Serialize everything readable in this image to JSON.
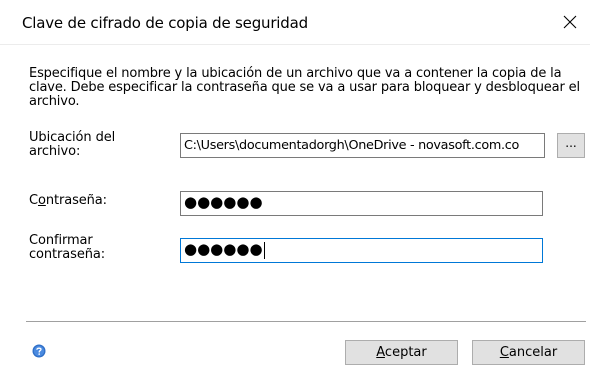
{
  "dialog": {
    "title": "Clave de cifrado de copia de seguridad",
    "description": "Especifique el nombre y la ubicación de un archivo que va a contener la copia de la clave. Debe especificar la contraseña que se va a usar para bloquear y desbloquear el archivo.",
    "location": {
      "label_line1": "Ubicación del",
      "label_line2": "archivo:",
      "value": "C:\\Users\\documentadorgh\\OneDrive - novasoft.com.co",
      "browse_label": "..."
    },
    "password": {
      "label_pre": "C",
      "label_mnemonic": "o",
      "label_post": "ntraseña:",
      "masked": "●●●●●●"
    },
    "confirm": {
      "label_line1": "Confirmar",
      "label_line2": "contraseña:",
      "masked": "●●●●●●"
    },
    "buttons": {
      "accept_mnemonic": "A",
      "accept_rest": "ceptar",
      "cancel_mnemonic": "C",
      "cancel_rest": "ancelar"
    },
    "icons": {
      "close": "close-icon",
      "help": "help-icon"
    },
    "colors": {
      "focus_border": "#0078d7",
      "help_blue": "#2f6fc7"
    }
  }
}
